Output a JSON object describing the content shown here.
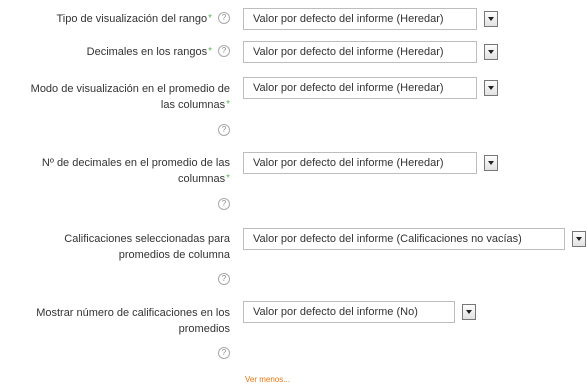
{
  "fields": [
    {
      "label": "Tipo de visualización del rango",
      "required_mark": "*",
      "help_icon": "question-circle-icon",
      "help_symbol": "?",
      "value": "Valor por defecto del informe (Heredar)"
    },
    {
      "label": "Decimales en los rangos",
      "required_mark": "*",
      "help_icon": "question-circle-icon",
      "help_symbol": "?",
      "value": "Valor por defecto del informe (Heredar)"
    },
    {
      "label_line1": "Modo de visualización en el promedio de",
      "label_line2": "las columnas",
      "required_mark": "*",
      "help_icon": "question-circle-icon",
      "help_symbol": "?",
      "value": "Valor por defecto del informe (Heredar)"
    },
    {
      "label_line1": "Nº de decimales en el promedio de las",
      "label_line2": "columnas",
      "required_mark": "*",
      "help_icon": "question-circle-icon",
      "help_symbol": "?",
      "value": "Valor por defecto del informe (Heredar)"
    },
    {
      "label_line1": "Calificaciones seleccionadas para",
      "label_line2": "promedios de columna",
      "help_icon": "question-circle-icon",
      "help_symbol": "?",
      "value": "Valor por defecto del informe (Calificaciones no vacías)"
    },
    {
      "label_line1": "Mostrar número de calificaciones en los",
      "label_line2": "promedios",
      "help_icon": "question-circle-icon",
      "help_symbol": "?",
      "value": "Valor por defecto del informe (No)"
    }
  ],
  "show_less_link": "Ver menos...",
  "dropdown_icon": "chevron-down-icon",
  "colors": {
    "required": "#5cb85c",
    "link": "#e8770e",
    "text": "#333333",
    "border": "#bdbdbd"
  }
}
